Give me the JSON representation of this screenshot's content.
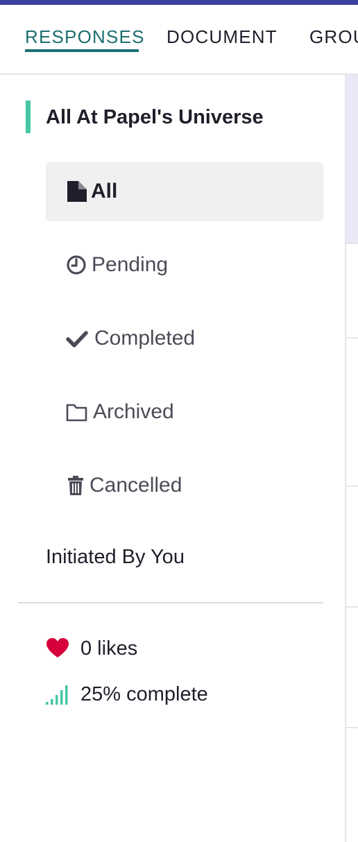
{
  "tabs": [
    {
      "label": "RESPONSES",
      "active": true
    },
    {
      "label": "DOCUMENT",
      "active": false
    },
    {
      "label": "GROU",
      "active": false
    }
  ],
  "sidebar": {
    "section_title": "All At Papel's Universe",
    "filters": [
      {
        "label": "All",
        "icon": "file-icon",
        "selected": true
      },
      {
        "label": "Pending",
        "icon": "clock-icon",
        "selected": false
      },
      {
        "label": "Completed",
        "icon": "check-icon",
        "selected": false
      },
      {
        "label": "Archived",
        "icon": "folder-icon",
        "selected": false
      },
      {
        "label": "Cancelled",
        "icon": "trash-icon",
        "selected": false
      }
    ],
    "initiated_label": "Initiated By You"
  },
  "stats": {
    "likes": "0 likes",
    "progress": "25% complete",
    "progress_value": 0.25
  },
  "colors": {
    "top_bar": "#3b3f9e",
    "active_tab": "#1b6e70",
    "accent": "#47c6a4",
    "heart": "#d6003b"
  }
}
